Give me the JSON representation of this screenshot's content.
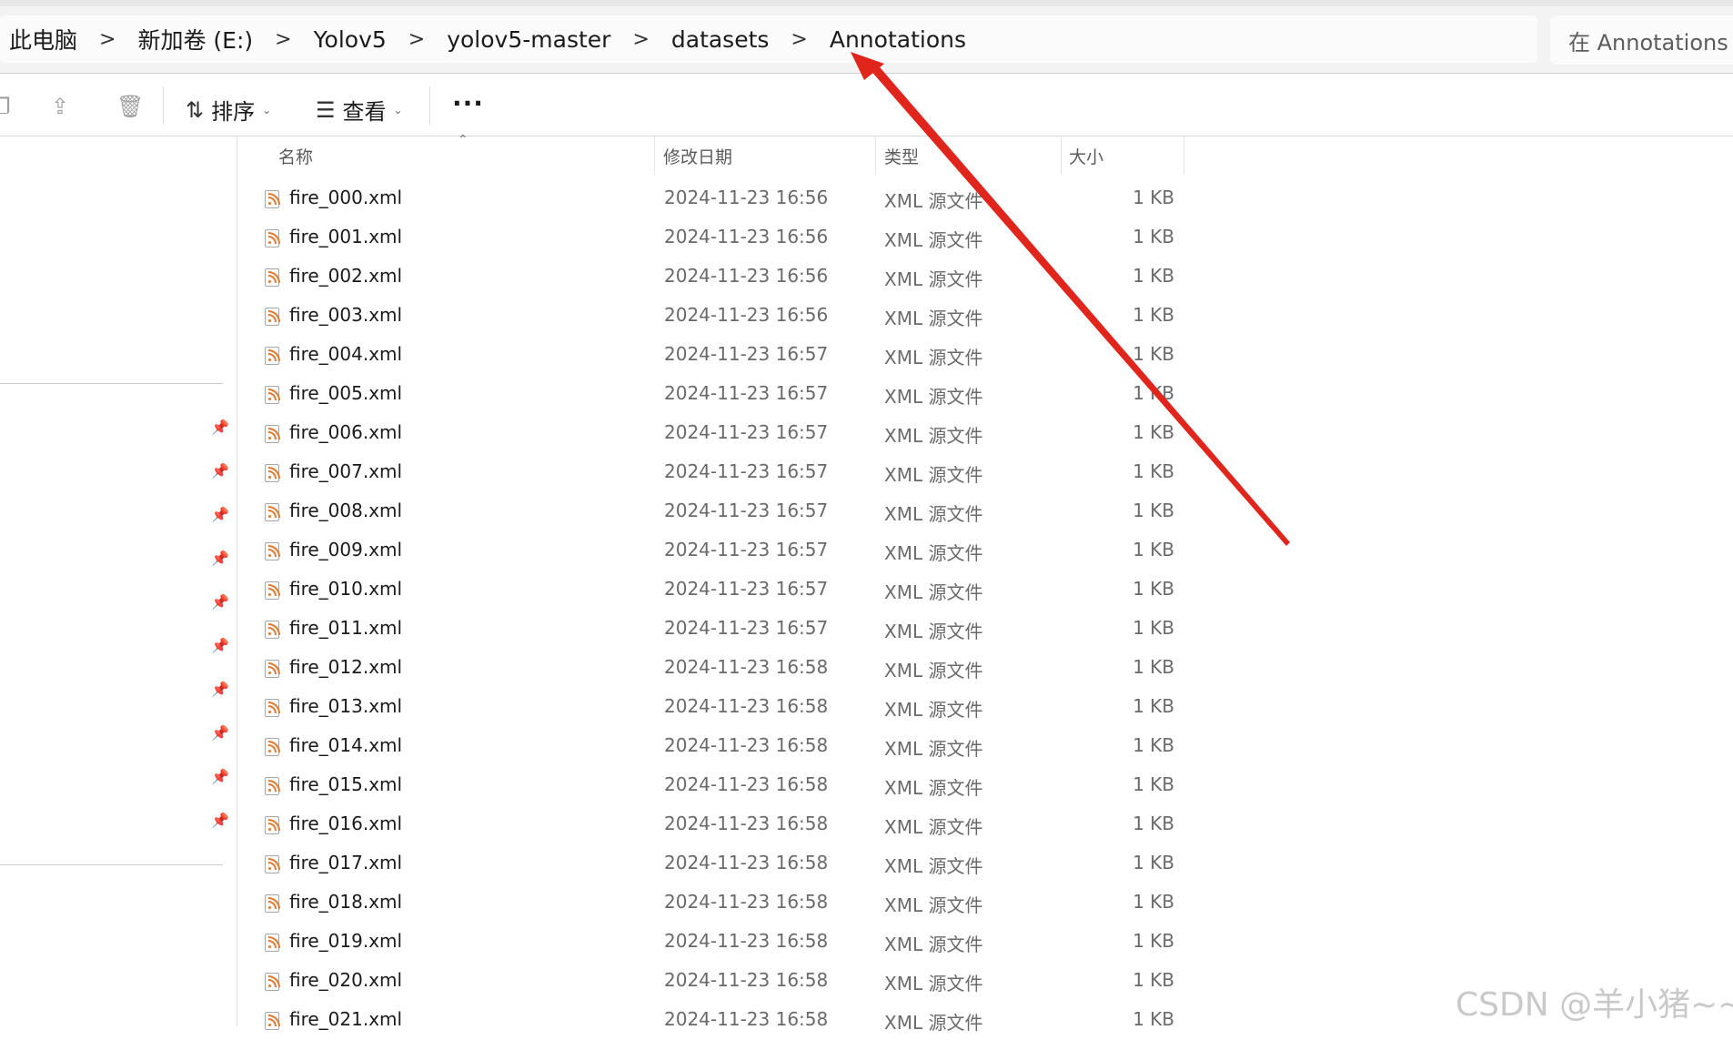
{
  "breadcrumb": {
    "items": [
      "此电脑",
      "新加卷 (E:)",
      "Yolov5",
      "yolov5-master",
      "datasets",
      "Annotations"
    ],
    "separator": ">"
  },
  "search": {
    "text": "在 Annotations 中"
  },
  "toolbar": {
    "sort_label": "排序",
    "view_label": "查看",
    "more_label": "···",
    "sort_icon": "⇅",
    "view_icon": "☰"
  },
  "columns": {
    "name": "名称",
    "date": "修改日期",
    "type": "类型",
    "size": "大小"
  },
  "files": [
    {
      "name": "fire_000.xml",
      "date": "2024-11-23 16:56",
      "type": "XML 源文件",
      "size": "1 KB"
    },
    {
      "name": "fire_001.xml",
      "date": "2024-11-23 16:56",
      "type": "XML 源文件",
      "size": "1 KB"
    },
    {
      "name": "fire_002.xml",
      "date": "2024-11-23 16:56",
      "type": "XML 源文件",
      "size": "1 KB"
    },
    {
      "name": "fire_003.xml",
      "date": "2024-11-23 16:56",
      "type": "XML 源文件",
      "size": "1 KB"
    },
    {
      "name": "fire_004.xml",
      "date": "2024-11-23 16:57",
      "type": "XML 源文件",
      "size": "1 KB"
    },
    {
      "name": "fire_005.xml",
      "date": "2024-11-23 16:57",
      "type": "XML 源文件",
      "size": "1 KB"
    },
    {
      "name": "fire_006.xml",
      "date": "2024-11-23 16:57",
      "type": "XML 源文件",
      "size": "1 KB"
    },
    {
      "name": "fire_007.xml",
      "date": "2024-11-23 16:57",
      "type": "XML 源文件",
      "size": "1 KB"
    },
    {
      "name": "fire_008.xml",
      "date": "2024-11-23 16:57",
      "type": "XML 源文件",
      "size": "1 KB"
    },
    {
      "name": "fire_009.xml",
      "date": "2024-11-23 16:57",
      "type": "XML 源文件",
      "size": "1 KB"
    },
    {
      "name": "fire_010.xml",
      "date": "2024-11-23 16:57",
      "type": "XML 源文件",
      "size": "1 KB"
    },
    {
      "name": "fire_011.xml",
      "date": "2024-11-23 16:57",
      "type": "XML 源文件",
      "size": "1 KB"
    },
    {
      "name": "fire_012.xml",
      "date": "2024-11-23 16:58",
      "type": "XML 源文件",
      "size": "1 KB"
    },
    {
      "name": "fire_013.xml",
      "date": "2024-11-23 16:58",
      "type": "XML 源文件",
      "size": "1 KB"
    },
    {
      "name": "fire_014.xml",
      "date": "2024-11-23 16:58",
      "type": "XML 源文件",
      "size": "1 KB"
    },
    {
      "name": "fire_015.xml",
      "date": "2024-11-23 16:58",
      "type": "XML 源文件",
      "size": "1 KB"
    },
    {
      "name": "fire_016.xml",
      "date": "2024-11-23 16:58",
      "type": "XML 源文件",
      "size": "1 KB"
    },
    {
      "name": "fire_017.xml",
      "date": "2024-11-23 16:58",
      "type": "XML 源文件",
      "size": "1 KB"
    },
    {
      "name": "fire_018.xml",
      "date": "2024-11-23 16:58",
      "type": "XML 源文件",
      "size": "1 KB"
    },
    {
      "name": "fire_019.xml",
      "date": "2024-11-23 16:58",
      "type": "XML 源文件",
      "size": "1 KB"
    },
    {
      "name": "fire_020.xml",
      "date": "2024-11-23 16:58",
      "type": "XML 源文件",
      "size": "1 KB"
    },
    {
      "name": "fire_021.xml",
      "date": "2024-11-23 16:58",
      "type": "XML 源文件",
      "size": "1 KB"
    }
  ],
  "annotation": {
    "arrow_color": "#e0261c"
  },
  "watermark": "CSDN @羊小猪~~"
}
